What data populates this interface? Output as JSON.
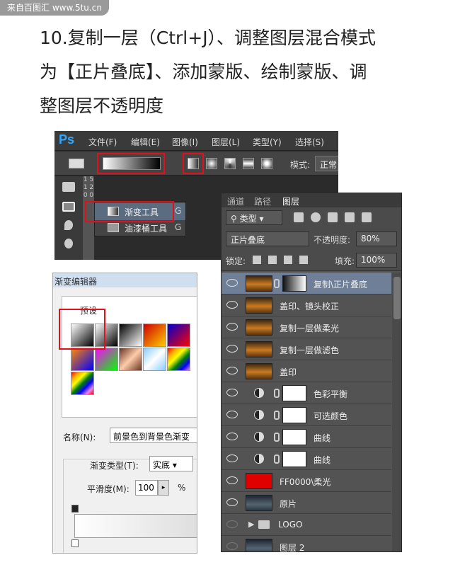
{
  "watermark_top": "来自百图汇 www.5tu.cn",
  "title_lines": [
    "10.复制一层（Ctrl+J）、调整图层混合模式",
    "为【正片叠底】、添加蒙版、绘制蒙版、调",
    "整图层不透明度"
  ],
  "ps": {
    "logo": "Ps",
    "menus": [
      "文件(F)",
      "编辑(E)",
      "图像(I)",
      "图层(L)",
      "类型(Y)",
      "选择(S)"
    ],
    "mode_label": "模式:",
    "mode_value": "正常",
    "ruler_text": "1 5 1 2 0 0",
    "flyout": [
      {
        "label": "渐变工具",
        "key": "G"
      },
      {
        "label": "油漆桶工具",
        "key": "G"
      }
    ]
  },
  "gradient_editor": {
    "title": "渐变编辑器",
    "presets_label": "预设",
    "name_label": "名称(N):",
    "name_value": "前景色到背景色渐变",
    "type_label": "渐变类型(T):",
    "type_value": "实底",
    "smooth_label": "平滑度(M):",
    "smooth_value": "100",
    "smooth_unit": "%"
  },
  "layers_panel": {
    "tabs": [
      "通道",
      "路径",
      "图层"
    ],
    "active_tab": "图层",
    "kind_filter": "类型",
    "blend_mode": "正片叠底",
    "opacity_label": "不透明度:",
    "opacity_value": "80%",
    "lock_label": "锁定:",
    "fill_label": "填充:",
    "fill_value": "100%",
    "layers": [
      {
        "name": "复制\\正片叠底",
        "thumb": "img",
        "mask": "gradient",
        "visible": true,
        "selected": true
      },
      {
        "name": "盖印、镜头校正",
        "thumb": "img",
        "visible": true
      },
      {
        "name": "复制一层做柔光",
        "thumb": "img",
        "visible": true
      },
      {
        "name": "复制一层做滤色",
        "thumb": "img",
        "visible": true
      },
      {
        "name": "盖印",
        "thumb": "img",
        "visible": true
      },
      {
        "name": "色彩平衡",
        "thumb": "adjustment",
        "mask": "white",
        "visible": true
      },
      {
        "name": "可选颜色",
        "thumb": "adjustment",
        "mask": "white",
        "visible": true
      },
      {
        "name": "曲线",
        "thumb": "adjustment",
        "mask": "white",
        "visible": true
      },
      {
        "name": "曲线",
        "thumb": "adjustment",
        "mask": "white",
        "visible": true
      },
      {
        "name": "FF0000\\柔光",
        "thumb": "red",
        "visible": true
      },
      {
        "name": "原片",
        "thumb": "dark",
        "visible": true
      },
      {
        "name": "LOGO",
        "thumb": "folder",
        "visible": false
      },
      {
        "name": "图层 2",
        "thumb": "dark",
        "visible": false
      }
    ]
  },
  "colors": {
    "highlight_red": "#e0101c",
    "ps_dark": "#2b2b2b",
    "panel_gray": "#535353",
    "selected_layer": "#6f7f97"
  }
}
